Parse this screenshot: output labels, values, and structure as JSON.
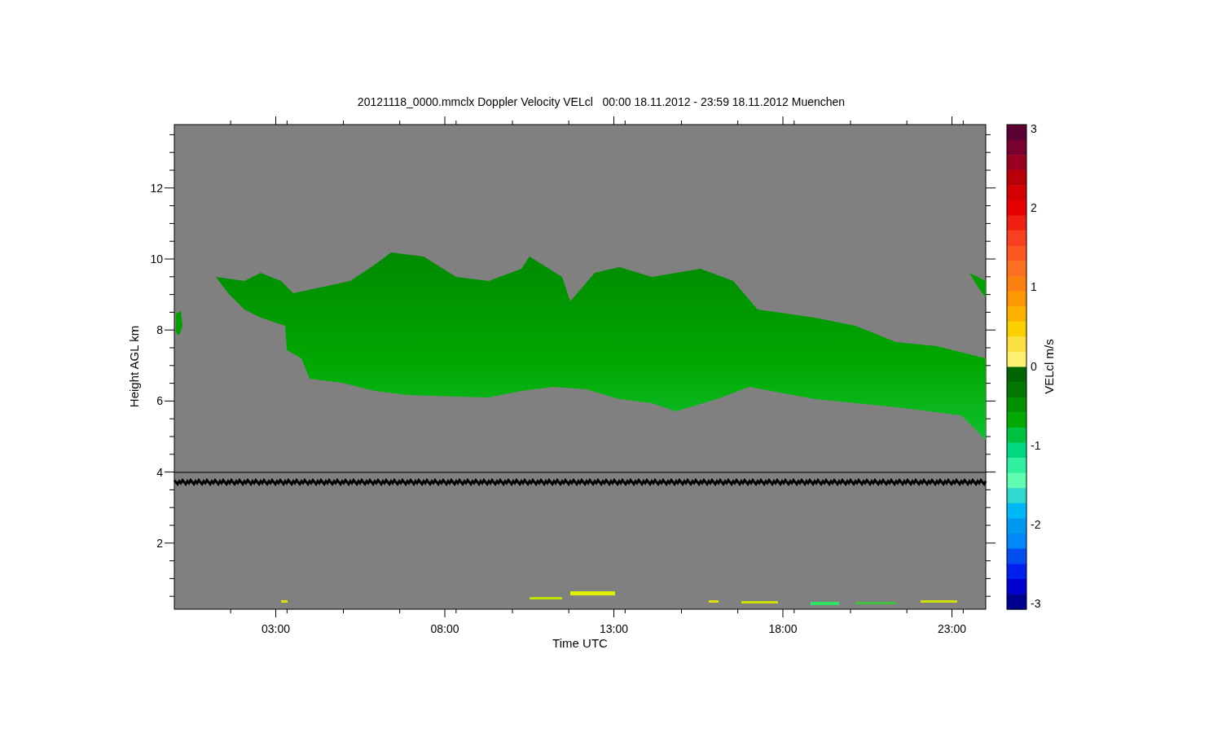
{
  "figure": {
    "title": "20121118_0000.mmclx Doppler Velocity VELcl   00:00 18.11.2012 - 23:59 18.11.2012 Muenchen",
    "plot": {
      "xlabel": "Time UTC",
      "ylabel": "Height AGL km",
      "xticks": [
        "03:00",
        "08:00",
        "13:00",
        "18:00",
        "23:00"
      ],
      "yticks": [
        "12",
        "10",
        "8",
        "6",
        "4",
        "2"
      ]
    },
    "colorbar": {
      "label": "VELcl m/s",
      "ticks": [
        "3",
        "2",
        "1",
        "0",
        "-1",
        "-2",
        "-3"
      ]
    }
  }
}
